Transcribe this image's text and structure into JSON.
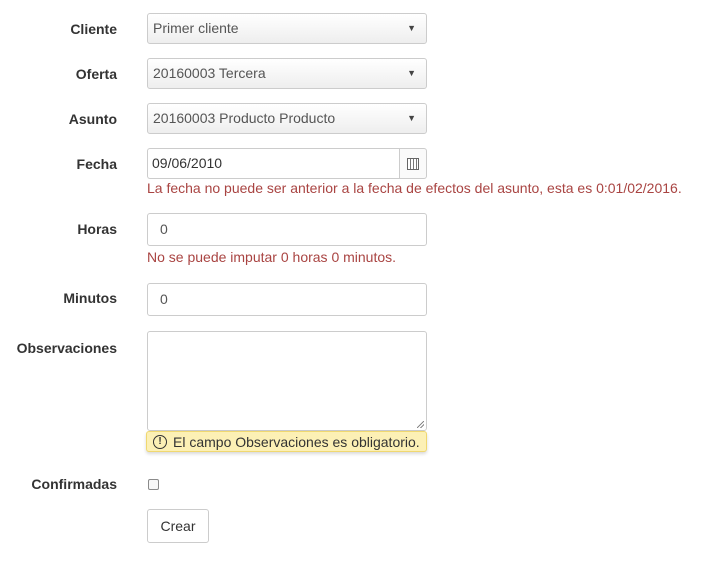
{
  "form": {
    "cliente": {
      "label": "Cliente",
      "value": "Primer cliente"
    },
    "oferta": {
      "label": "Oferta",
      "value": "20160003 Tercera"
    },
    "asunto": {
      "label": "Asunto",
      "value": "20160003 Producto Producto"
    },
    "fecha": {
      "label": "Fecha",
      "value": "09/06/2010",
      "error": "La fecha no puede ser anterior a la fecha de efectos del asunto, esta es 0:01/02/2016."
    },
    "horas": {
      "label": "Horas",
      "value": "0",
      "error": "No se puede imputar 0 horas 0 minutos."
    },
    "minutos": {
      "label": "Minutos",
      "value": "0"
    },
    "observaciones": {
      "label": "Observaciones",
      "value": "",
      "warning": "El campo Observaciones es obligatorio."
    },
    "confirmadas": {
      "label": "Confirmadas",
      "checked": false
    },
    "submit_label": "Crear"
  },
  "icons": {
    "select_caret": "caret-down-icon",
    "date_picker": "calendar-icon",
    "warning": "exclamation-circle-icon"
  },
  "colors": {
    "error_text": "#a94442",
    "warning_bg": "#fcf0b5"
  }
}
